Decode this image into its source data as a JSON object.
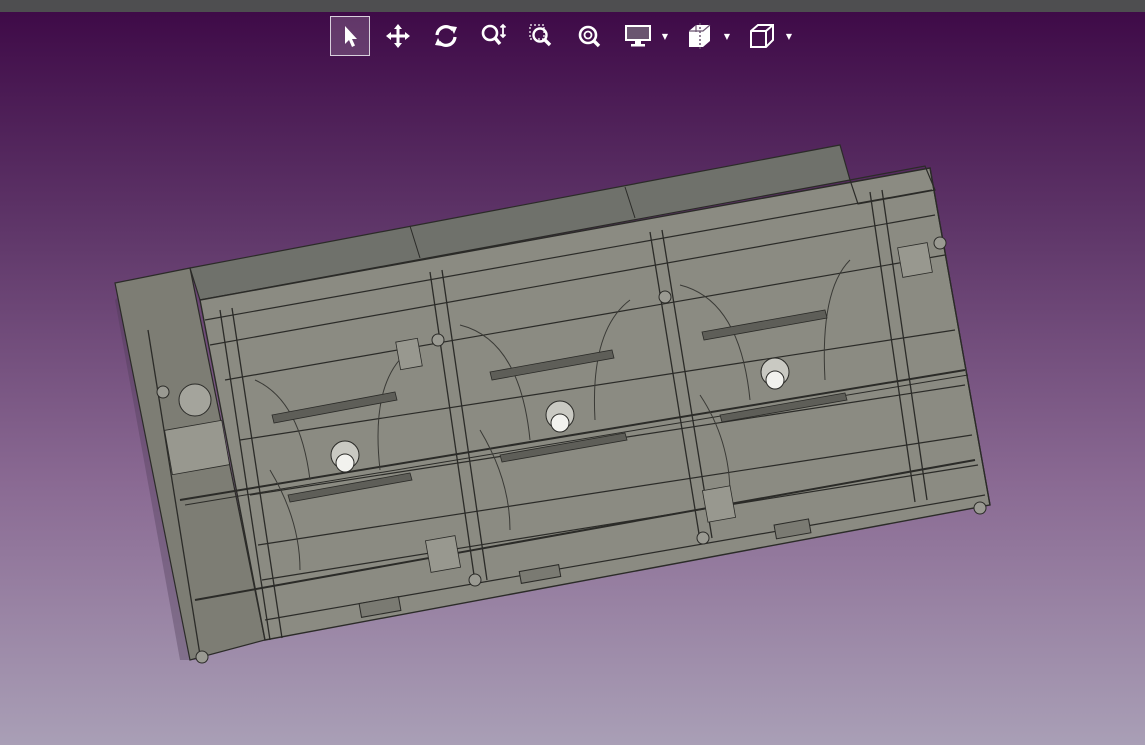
{
  "viewer": {
    "colors": {
      "background_top": "#3d0846",
      "background_bottom": "#a99fb6",
      "toolbar_bar": "#4e4e50",
      "model_fill": "#8a8a80",
      "model_stroke": "#2b2b28"
    }
  },
  "toolbar": {
    "tools": [
      {
        "name": "select-tool",
        "icon": "cursor-arrow-icon",
        "active": true
      },
      {
        "name": "pan-tool",
        "icon": "move-arrows-icon",
        "active": false
      },
      {
        "name": "rotate-tool",
        "icon": "rotate-icon",
        "active": false
      },
      {
        "name": "zoom-tool",
        "icon": "zoom-icon",
        "active": false
      },
      {
        "name": "zoom-window-tool",
        "icon": "zoom-window-icon",
        "active": false
      },
      {
        "name": "zoom-fit-tool",
        "icon": "zoom-fit-icon",
        "active": false
      },
      {
        "name": "display-mode-tool",
        "icon": "monitor-icon",
        "active": false,
        "has_dropdown": true
      },
      {
        "name": "section-tool",
        "icon": "section-cube-icon",
        "active": false,
        "has_dropdown": true
      },
      {
        "name": "view-orientation-tool",
        "icon": "cube-view-icon",
        "active": false,
        "has_dropdown": true
      }
    ]
  },
  "model": {
    "description_icon": "cad-assembly-frame"
  }
}
